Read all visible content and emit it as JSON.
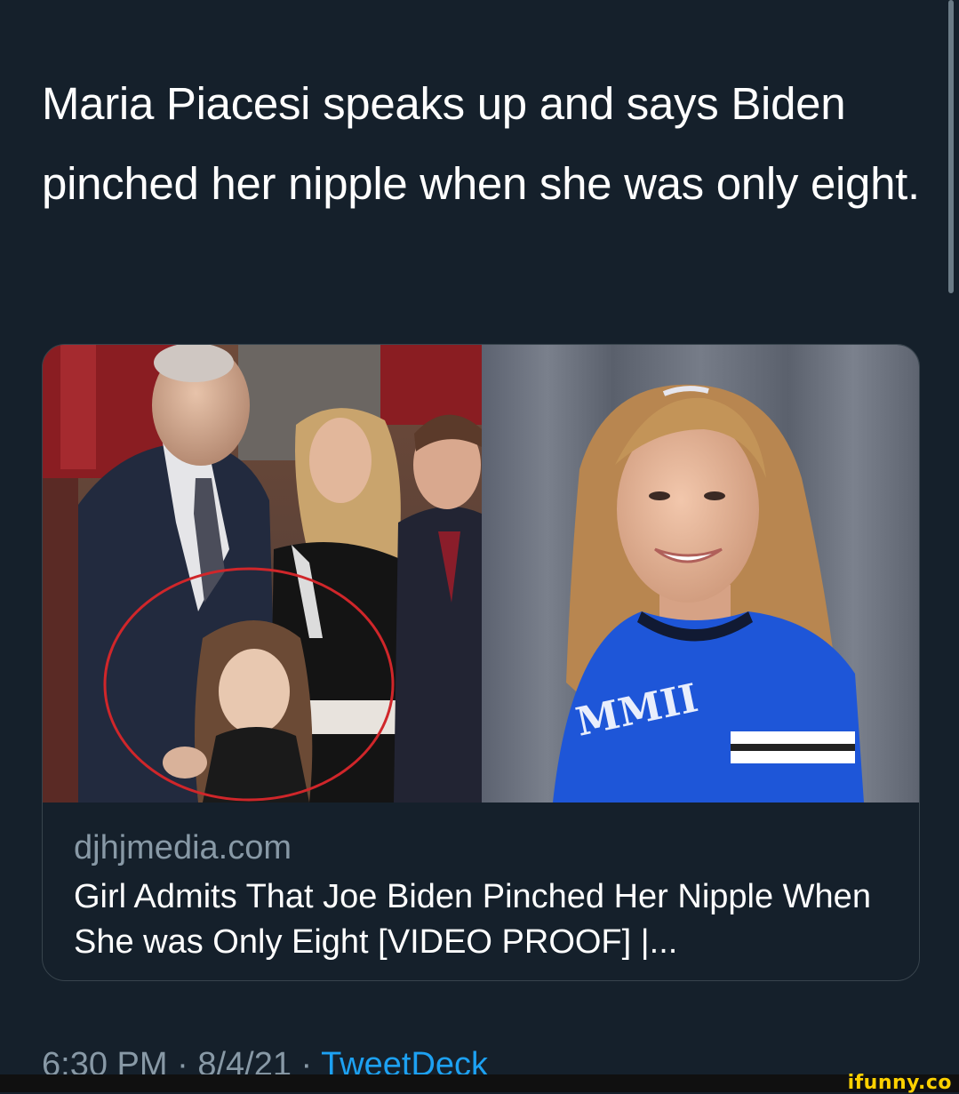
{
  "tweet": {
    "text": "Maria Piacesi speaks up and says Biden pinched her nipple when she was only eight."
  },
  "card": {
    "domain": "djhjmedia.com",
    "title": "Girl Admits That Joe Biden Pinched Her Nipple When She was Only Eight [VIDEO PROOF] |...",
    "images": [
      {
        "alt": "Video still of man in suit next to a woman and a young girl circled in red"
      },
      {
        "alt": "Smiling teenage girl in blue jersey against gray curtain"
      }
    ]
  },
  "meta": {
    "time": "6:30 PM",
    "separator1": " · ",
    "date": "8/4/21",
    "separator2": " · ",
    "source": "TweetDeck"
  },
  "watermark": {
    "text": "ifunny.co"
  },
  "colors": {
    "background": "#15202b",
    "text": "#ffffff",
    "secondary": "#8899a6",
    "link": "#1da1f2",
    "border": "#38444d",
    "watermark": "#fdd100"
  }
}
